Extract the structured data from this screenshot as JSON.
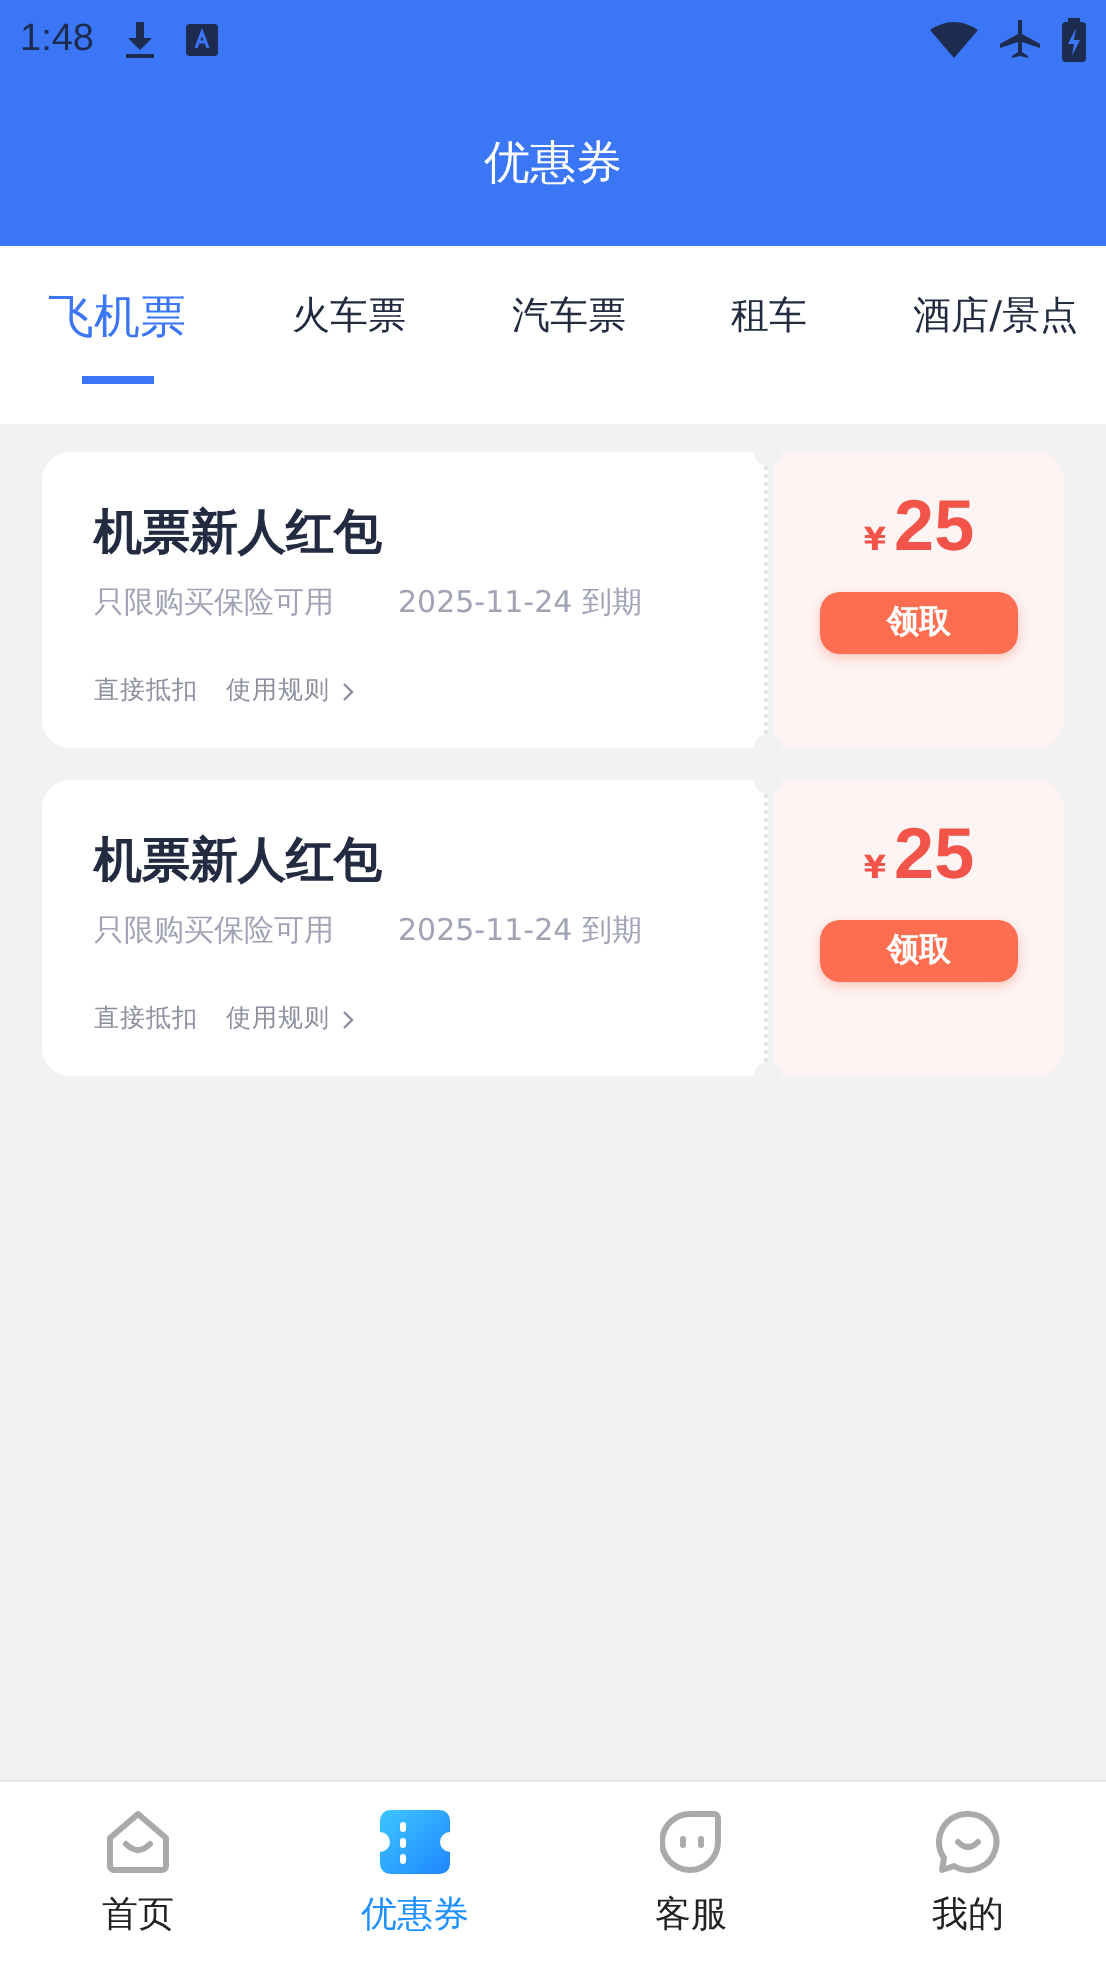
{
  "status_bar": {
    "time": "1:48"
  },
  "header": {
    "title": "优惠券"
  },
  "tabs": [
    {
      "label": "飞机票",
      "selected": true
    },
    {
      "label": "火车票",
      "selected": false
    },
    {
      "label": "汽车票",
      "selected": false
    },
    {
      "label": "租车",
      "selected": false
    },
    {
      "label": "酒店/景点",
      "selected": false
    }
  ],
  "coupons": [
    {
      "title": "机票新人红包",
      "condition": "只限购买保险可用",
      "expiry": "2025-11-24 到期",
      "type_label": "直接抵扣",
      "rules_link": "使用规则",
      "currency": "¥",
      "amount": "25",
      "button": "领取"
    },
    {
      "title": "机票新人红包",
      "condition": "只限购买保险可用",
      "expiry": "2025-11-24 到期",
      "type_label": "直接抵扣",
      "rules_link": "使用规则",
      "currency": "¥",
      "amount": "25",
      "button": "领取"
    }
  ],
  "bottom_nav": [
    {
      "kind": "home",
      "label": "首页",
      "selected": false
    },
    {
      "kind": "coupon",
      "label": "优惠券",
      "selected": true
    },
    {
      "kind": "service",
      "label": "客服",
      "selected": false
    },
    {
      "kind": "profile",
      "label": "我的",
      "selected": false
    }
  ]
}
